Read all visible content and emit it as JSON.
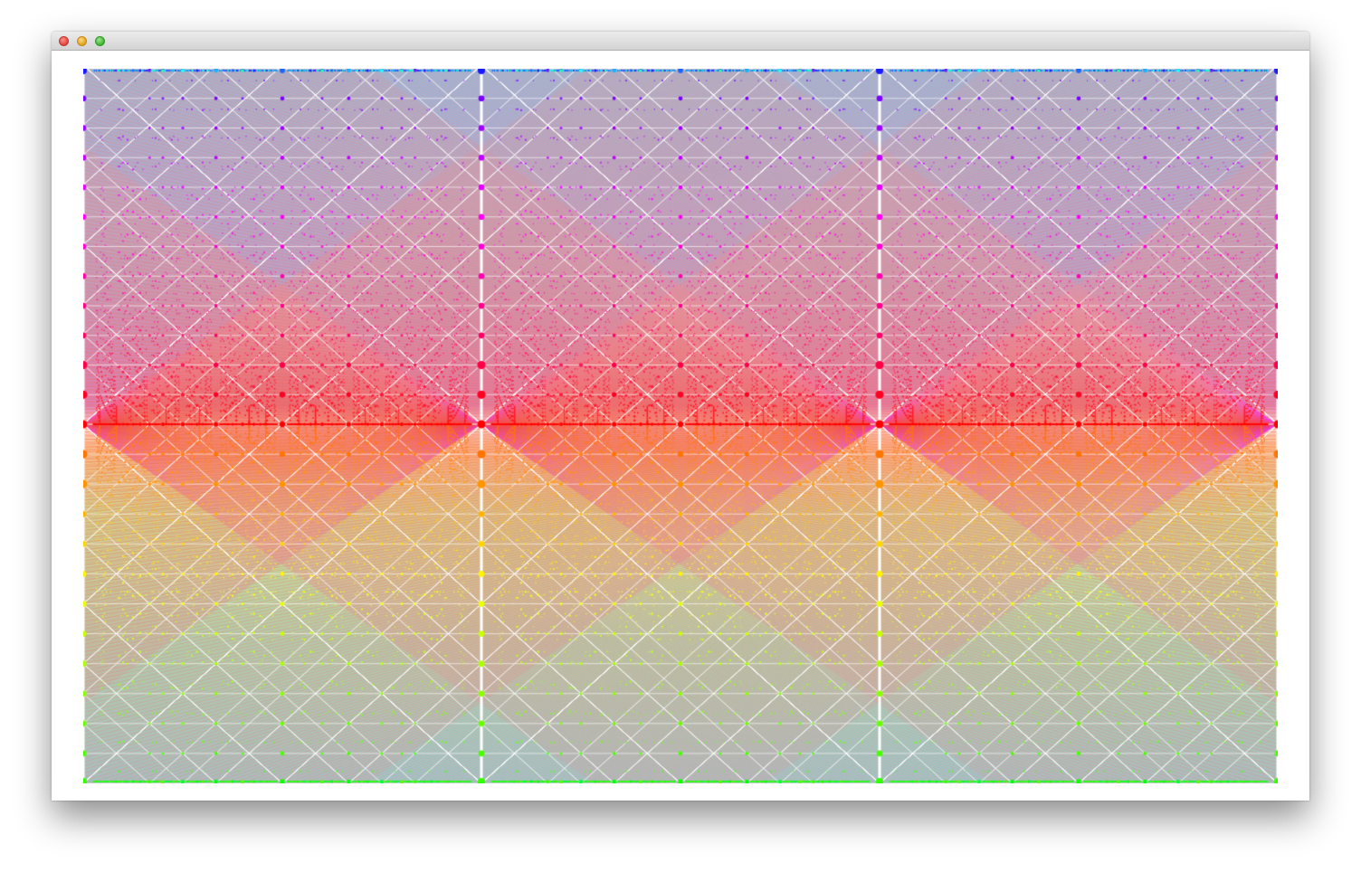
{
  "window": {
    "title": "",
    "controls": [
      {
        "name": "close",
        "icon": "close-icon",
        "color": "#e0443e"
      },
      {
        "name": "minimize",
        "icon": "minimize-icon",
        "color": "#e1a116"
      },
      {
        "name": "zoom",
        "icon": "zoom-icon",
        "color": "#3fb132"
      }
    ]
  },
  "visualization": {
    "description_kind": "generative-pattern",
    "period_columns": 3,
    "palette": {
      "upper_center": "#ff0000",
      "upper_mid": "#ff00ff",
      "upper_far": "#5500ff",
      "lower_center": "#ff6600",
      "lower_mid": "#ffdd00",
      "lower_far": "#33ff00",
      "background_tint": "#a8c8c0",
      "ray": "#ffffff"
    }
  }
}
